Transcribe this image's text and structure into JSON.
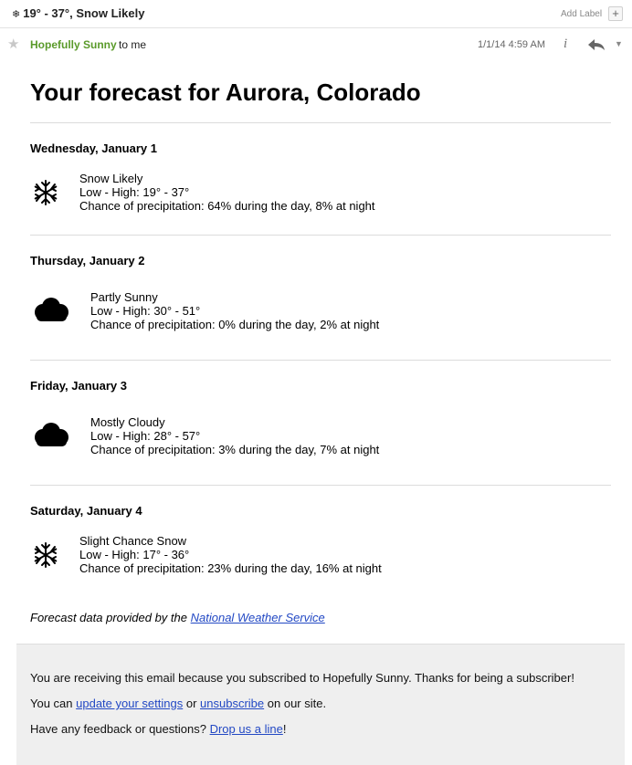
{
  "header": {
    "subject_icon": "snowflake-icon",
    "subject": "19° - 37°, Snow Likely",
    "add_label": "Add Label",
    "add_label_button": "+"
  },
  "message": {
    "sender": "Hopefully Sunny",
    "recipient": "to me",
    "date": "1/1/14 4:59 AM",
    "info_label": "i",
    "reply_icon": "reply-icon"
  },
  "email": {
    "title": "Your forecast for Aurora, Colorado",
    "days": [
      {
        "heading": "Wednesday, January 1",
        "icon": "snowflake-icon",
        "condition": "Snow Likely",
        "temps": "Low - High: 19° - 37°",
        "precip": "Chance of precipitation: 64% during the day, 8% at night"
      },
      {
        "heading": "Thursday, January 2",
        "icon": "cloud-icon",
        "condition": "Partly Sunny",
        "temps": "Low - High: 30° - 51°",
        "precip": "Chance of precipitation: 0% during the day, 2% at night"
      },
      {
        "heading": "Friday, January 3",
        "icon": "cloud-icon",
        "condition": "Mostly Cloudy",
        "temps": "Low - High: 28° - 57°",
        "precip": "Chance of precipitation: 3% during the day, 7% at night"
      },
      {
        "heading": "Saturday, January 4",
        "icon": "snowflake-icon",
        "condition": "Slight Chance Snow",
        "temps": "Low - High: 17° - 36°",
        "precip": "Chance of precipitation: 23% during the day, 16% at night"
      }
    ],
    "credit_prefix": "Forecast data provided by the",
    "credit_link": "National Weather Service"
  },
  "footer": {
    "line1": "You are receiving this email because you subscribed to Hopefully Sunny. Thanks for being a subscriber!",
    "line2_prefix": "You can",
    "line2_link1": "update your settings",
    "line2_mid": "or",
    "line2_link2": "unsubscribe",
    "line2_suffix": "on our site.",
    "line3_prefix": "Have any feedback or questions?",
    "line3_link": "Drop us a line",
    "line3_suffix": "!"
  },
  "colors": {
    "sender": "#5a9a2a",
    "link": "#2248c4",
    "footer_bg": "#efefef"
  }
}
